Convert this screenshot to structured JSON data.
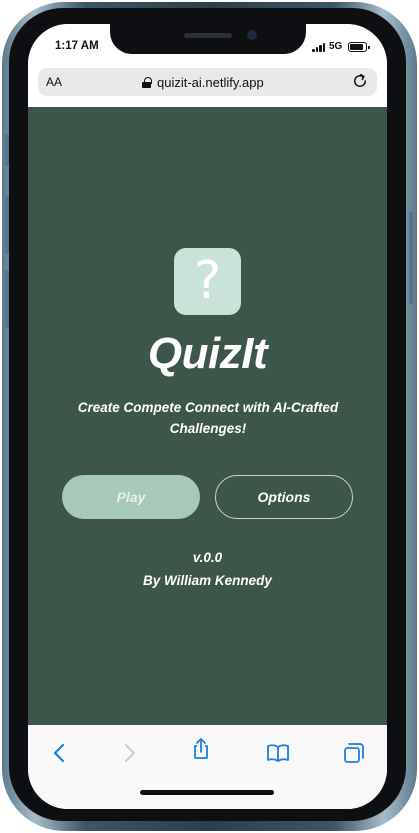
{
  "status_bar": {
    "time": "1:17 AM",
    "network": "5G"
  },
  "browser": {
    "reader_label": "AA",
    "url": "quizit-ai.netlify.app",
    "icons": [
      "reader-icon",
      "lock-icon",
      "reload-icon"
    ]
  },
  "app": {
    "logo_glyph": "?",
    "title": "QuizIt",
    "tagline": "Create Compete Connect with AI-Crafted Challenges!",
    "play_label": "Play",
    "options_label": "Options",
    "version": "v.0.0",
    "author": "By William Kennedy",
    "colors": {
      "background": "#3c574a",
      "logo": "#c9e3d9",
      "play_button": "#a6c9b9",
      "text": "#ffffff"
    }
  },
  "toolbar": {
    "icons": [
      "back-icon",
      "forward-icon",
      "share-icon",
      "bookmarks-icon",
      "tabs-icon"
    ],
    "accent": "#1a7fe0"
  }
}
